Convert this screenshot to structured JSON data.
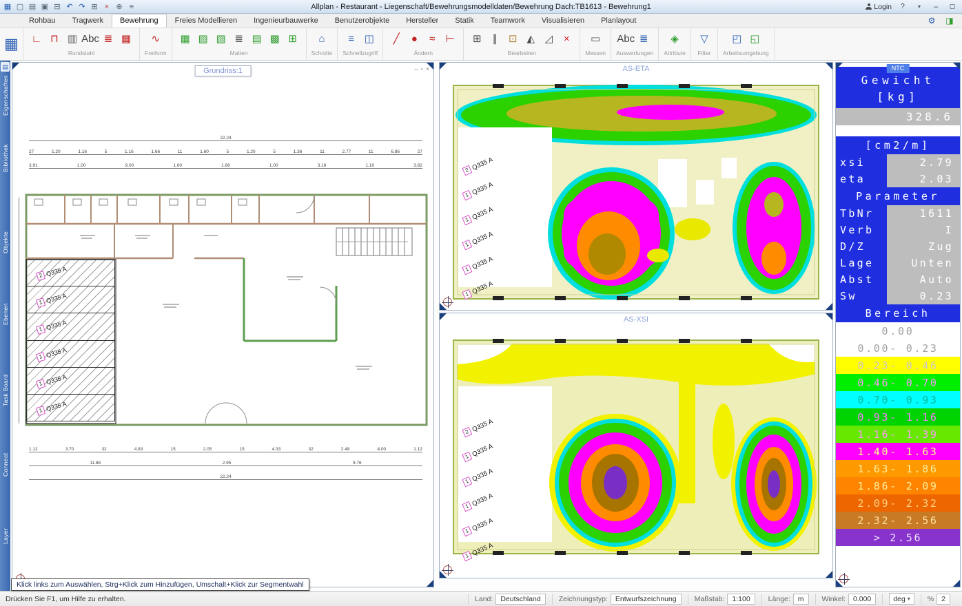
{
  "titlebar": {
    "title": "Allplan    - Restaurant - Liegenschaft/Bewehrungsmodelldaten/Bewehrung Dach:TB1613 - Bewehrung1",
    "login_label": "Login",
    "quick_icons": [
      {
        "name": "allplan-menu-icon",
        "glyph": "▦",
        "color": "#2a5fb4"
      },
      {
        "name": "new-document-icon",
        "glyph": "▢",
        "color": "#5a6a7a"
      },
      {
        "name": "open-project-icon",
        "glyph": "▤",
        "color": "#5a6a7a"
      },
      {
        "name": "save-icon",
        "glyph": "▣",
        "color": "#5a6a7a"
      },
      {
        "name": "print-icon",
        "glyph": "⊟",
        "color": "#5a6a7a"
      },
      {
        "name": "undo-icon",
        "glyph": "↶",
        "color": "#2a5fb4"
      },
      {
        "name": "redo-icon",
        "glyph": "↷",
        "color": "#2a5fb4"
      },
      {
        "name": "copy-icon",
        "glyph": "⊞",
        "color": "#5a6a7a"
      },
      {
        "name": "delete-icon",
        "glyph": "×",
        "color": "#c03030"
      },
      {
        "name": "link-icon",
        "glyph": "⊕",
        "color": "#5a6a7a"
      },
      {
        "name": "options-icon",
        "glyph": "≡",
        "color": "#5a6a7a"
      }
    ]
  },
  "ribbon": {
    "tabs": [
      {
        "name": "tab-rohbau",
        "label": "Rohbau"
      },
      {
        "name": "tab-tragwerk",
        "label": "Tragwerk"
      },
      {
        "name": "tab-bewehrung",
        "label": "Bewehrung",
        "active": true
      },
      {
        "name": "tab-freies-modellieren",
        "label": "Freies Modellieren"
      },
      {
        "name": "tab-ingenieurbauwerke",
        "label": "Ingenieurbauwerke"
      },
      {
        "name": "tab-benutzerobjekte",
        "label": "Benutzerobjekte"
      },
      {
        "name": "tab-hersteller",
        "label": "Hersteller"
      },
      {
        "name": "tab-statik",
        "label": "Statik"
      },
      {
        "name": "tab-teamwork",
        "label": "Teamwork"
      },
      {
        "name": "tab-visualisieren",
        "label": "Visualisieren"
      },
      {
        "name": "tab-planlayout",
        "label": "Planlayout"
      }
    ]
  },
  "toolbar": {
    "groups": [
      {
        "label": "Rundstahl",
        "icons": [
          {
            "name": "rebar-place-icon",
            "glyph": "∟",
            "color": "#c42020"
          },
          {
            "name": "rebar-extrude-icon",
            "glyph": "⊓",
            "color": "#c42020"
          },
          {
            "name": "rebar-fan-icon",
            "glyph": "▥",
            "color": "#606060"
          },
          {
            "name": "rebar-label-icon",
            "glyph": "Abc",
            "color": "#404040"
          },
          {
            "name": "rebar-schema-icon",
            "glyph": "≣",
            "color": "#c42020"
          },
          {
            "name": "rebar-area-icon",
            "glyph": "▦",
            "color": "#c42020"
          }
        ]
      },
      {
        "label": "Freiform",
        "icons": [
          {
            "name": "freeform-bar-icon",
            "glyph": "∿",
            "color": "#c42020"
          }
        ]
      },
      {
        "label": "Matten",
        "icons": [
          {
            "name": "mesh-place-icon",
            "glyph": "▦",
            "color": "#2f9e2f"
          },
          {
            "name": "mesh-span-icon",
            "glyph": "▨",
            "color": "#2f9e2f"
          },
          {
            "name": "mesh-cut-icon",
            "glyph": "▧",
            "color": "#2f9e2f"
          },
          {
            "name": "mesh-list-icon",
            "glyph": "≣",
            "color": "#505050"
          },
          {
            "name": "mesh-single-icon",
            "glyph": "▤",
            "color": "#2f9e2f"
          },
          {
            "name": "mesh-bend-icon",
            "glyph": "▩",
            "color": "#2f9e2f"
          },
          {
            "name": "mesh-check-icon",
            "glyph": "⊞",
            "color": "#2f9e2f"
          }
        ]
      },
      {
        "label": "Schnitte",
        "icons": [
          {
            "name": "section-house-icon",
            "glyph": "⌂",
            "color": "#2a5fb4"
          }
        ]
      },
      {
        "label": "Schnellzugriff",
        "icons": [
          {
            "name": "section-line-icon",
            "glyph": "≡",
            "color": "#2a5fb4"
          },
          {
            "name": "section-view-icon",
            "glyph": "◫",
            "color": "#2a5fb4"
          }
        ]
      },
      {
        "label": "Ändern",
        "icons": [
          {
            "name": "modify-pen-icon",
            "glyph": "╱",
            "color": "#c42020"
          },
          {
            "name": "modify-point-icon",
            "glyph": "●",
            "color": "#c42020"
          },
          {
            "name": "modify-wave-icon",
            "glyph": "≈",
            "color": "#c42020"
          },
          {
            "name": "modify-end-icon",
            "glyph": "⊢",
            "color": "#c42020"
          }
        ]
      },
      {
        "label": "Bearbeiten",
        "icons": [
          {
            "name": "copy-elements-icon",
            "glyph": "⊞",
            "color": "#4a4a4a"
          },
          {
            "name": "array-icon",
            "glyph": "∥",
            "color": "#4a4a4a"
          },
          {
            "name": "stamp-icon",
            "glyph": "⊡",
            "color": "#b08030"
          },
          {
            "name": "mirror-icon",
            "glyph": "◭",
            "color": "#4a4a4a"
          },
          {
            "name": "scale-icon",
            "glyph": "◿",
            "color": "#4a4a4a"
          },
          {
            "name": "delete-elements-icon",
            "glyph": "×",
            "color": "#d42020"
          }
        ]
      },
      {
        "label": "Messen",
        "icons": [
          {
            "name": "measure-icon",
            "glyph": "▭",
            "color": "#505050"
          }
        ]
      },
      {
        "label": "Auswertungen",
        "icons": [
          {
            "name": "report-text-icon",
            "glyph": "Abc",
            "color": "#404040"
          },
          {
            "name": "report-list-icon",
            "glyph": "≣",
            "color": "#2a5fb4"
          }
        ]
      },
      {
        "label": "Attribute",
        "icons": [
          {
            "name": "attribute-tag-icon",
            "glyph": "◈",
            "color": "#2f9e2f"
          }
        ]
      },
      {
        "label": "Filter",
        "icons": [
          {
            "name": "filter-funnel-icon",
            "glyph": "▽",
            "color": "#2a5fb4"
          }
        ]
      },
      {
        "label": "Arbeitsumgebung",
        "icons": [
          {
            "name": "layout-grid-icon",
            "glyph": "◰",
            "color": "#2a5fb4"
          },
          {
            "name": "layout-window-icon",
            "glyph": "◱",
            "color": "#2f9e2f"
          }
        ]
      }
    ]
  },
  "sidebar": {
    "items": [
      {
        "name": "sidebar-item-eigenschaften",
        "label": "Eigenschaften"
      },
      {
        "name": "sidebar-item-bibliothek",
        "label": "Bibliothek"
      },
      {
        "name": "sidebar-item-objekte",
        "label": "Objekte"
      },
      {
        "name": "sidebar-item-ebenen",
        "label": "Ebenen"
      },
      {
        "name": "sidebar-item-task-board",
        "label": "Task Board"
      },
      {
        "name": "sidebar-item-connect",
        "label": "Connect"
      },
      {
        "name": "sidebar-item-layer",
        "label": "Layer"
      }
    ]
  },
  "viewports": {
    "grundriss_title": "Grundriss:1",
    "eta_title": "AS-ETA",
    "xsi_title": "AS-XSI"
  },
  "plan": {
    "dims_top_total": "22.24",
    "dims_top_row2": [
      "27",
      "1.20",
      "1.16",
      "5",
      "1.16",
      "1.66",
      "11",
      "1.60",
      "5",
      "1.20",
      "5",
      "1.36",
      "11",
      "2.77",
      "11",
      "6.86",
      "27"
    ],
    "dims_top_row3": [
      "3.91",
      "1.00",
      "9.00",
      "1.00",
      "1.68",
      "1.00",
      "3.16",
      "1.10",
      "3.82"
    ],
    "dims_bottom_row1": [
      "1.12",
      "3.70",
      "32",
      "4.83",
      "15",
      "2.05",
      "15",
      "4.33",
      "32",
      "2.48",
      "4.00",
      "1.12"
    ],
    "dims_bottom_row2": [
      "11.88",
      "2.95",
      "9.76"
    ],
    "dims_bottom_total": "22.24",
    "panels": [
      {
        "num": "2",
        "label": "Q335 A"
      },
      {
        "num": "1",
        "label": "Q335 A"
      },
      {
        "num": "1",
        "label": "Q335 A"
      },
      {
        "num": "1",
        "label": "Q335 A"
      },
      {
        "num": "1",
        "label": "Q335 A"
      },
      {
        "num": "1",
        "label": "Q335 A"
      }
    ]
  },
  "contours": {
    "labels": [
      {
        "num": "2",
        "label": "Q335 A"
      },
      {
        "num": "1",
        "label": "Q335 A"
      },
      {
        "num": "1",
        "label": "Q335 A"
      },
      {
        "num": "1",
        "label": "Q335 A"
      },
      {
        "num": "1",
        "label": "Q335 A"
      },
      {
        "num": "1",
        "label": "Q335 A"
      }
    ]
  },
  "legend": {
    "tag": "NTC",
    "weight_title_line1": "Gewicht",
    "weight_title_line2": "[kg]",
    "weight_value": "328.6",
    "unit_header": "[cm2/m]",
    "ratio_rows": [
      {
        "label": "xsi",
        "value": "2.79"
      },
      {
        "label": "eta",
        "value": "2.03"
      }
    ],
    "parameter_header": "Parameter",
    "parameters": [
      {
        "label": "TbNr",
        "value": "1611"
      },
      {
        "label": "Verb",
        "value": "I"
      },
      {
        "label": "D/Z",
        "value": "Zug"
      },
      {
        "label": "Lage",
        "value": "Unten"
      },
      {
        "label": "Abst",
        "value": "Auto"
      },
      {
        "label": "Sw",
        "value": "0.23"
      }
    ],
    "bereich_header": "Bereich",
    "scale": [
      {
        "label": "0.00",
        "bg": "#ffffff",
        "fg": "#a0a0a0"
      },
      {
        "label": "0.00- 0.23",
        "bg": "#ffffff",
        "fg": "#a0a0a0"
      },
      {
        "label": "0.23- 0.46",
        "bg": "#ffff00",
        "fg": "#c8c8c8"
      },
      {
        "label": "0.46- 0.70",
        "bg": "#00ee00",
        "fg": "#ff9aff"
      },
      {
        "label": "0.70- 0.93",
        "bg": "#00ffff",
        "fg": "#00bb99"
      },
      {
        "label": "0.93- 1.16",
        "bg": "#00d400",
        "fg": "#ff7aff"
      },
      {
        "label": "1.16- 1.39",
        "bg": "#66e800",
        "fg": "#ff9aff"
      },
      {
        "label": "1.40- 1.63",
        "bg": "#ff00ff",
        "fg": "#ffff88"
      },
      {
        "label": "1.63- 1.86",
        "bg": "#ff9900",
        "fg": "#fff0a0"
      },
      {
        "label": "1.86- 2.09",
        "bg": "#ff8400",
        "fg": "#fff0a0"
      },
      {
        "label": "2.09- 2.32",
        "bg": "#ee6600",
        "fg": "#ffd080"
      },
      {
        "label": "2.32- 2.56",
        "bg": "#c87a24",
        "fg": "#ffe0a0"
      },
      {
        "label": "> 2.56",
        "bg": "#8833cc",
        "fg": "#f0e6ff"
      }
    ]
  },
  "statusbar": {
    "tooltip": "Klick links zum Auswählen, Strg+Klick zum Hinzufügen, Umschalt+Klick zur Segmentwahl",
    "hint": "Drücken Sie F1, um Hilfe zu erhalten.",
    "fields": [
      {
        "label": "Land:",
        "value": "Deutschland"
      },
      {
        "label": "Zeichnungstyp:",
        "value": "Entwurfszeichnung"
      },
      {
        "label": "Maßstab:",
        "value": "1:100"
      },
      {
        "label": "Länge:",
        "value": "m"
      },
      {
        "label": "Winkel:",
        "value": "0.000"
      }
    ],
    "angle_unit": "deg",
    "percent_label": "%",
    "percent_value": "2"
  }
}
